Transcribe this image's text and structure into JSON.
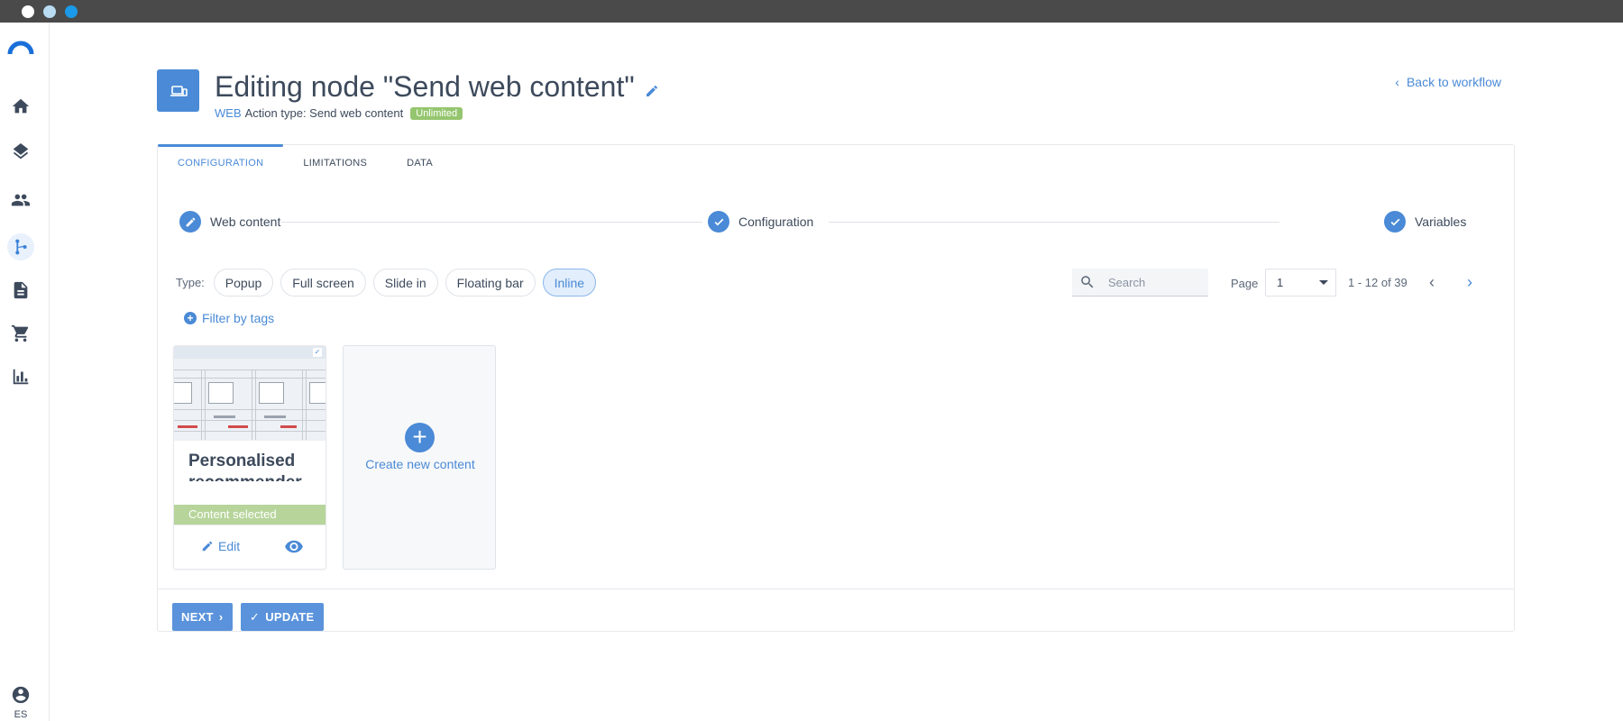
{
  "header": {
    "title": "Editing node \"Send web content\"",
    "channel": "WEB",
    "action_type": "Action type: Send web content",
    "badge": "Unlimited",
    "back_link": "Back to workflow"
  },
  "sidebar": {
    "items": [
      {
        "icon": "home-icon"
      },
      {
        "icon": "layers-icon"
      },
      {
        "icon": "people-icon"
      },
      {
        "icon": "workflow-icon",
        "active": true
      },
      {
        "icon": "document-icon"
      },
      {
        "icon": "cart-icon"
      },
      {
        "icon": "bar-chart-icon"
      }
    ],
    "user_label": "ES"
  },
  "tabs": [
    {
      "label": "CONFIGURATION",
      "active": true
    },
    {
      "label": "LIMITATIONS"
    },
    {
      "label": "DATA"
    }
  ],
  "stepper": {
    "steps": [
      {
        "label": "Web content",
        "icon": "pencil-icon"
      },
      {
        "label": "Configuration",
        "icon": "check-icon"
      },
      {
        "label": "Variables",
        "icon": "check-icon"
      }
    ]
  },
  "filters": {
    "type_label": "Type:",
    "types": [
      "Popup",
      "Full screen",
      "Slide in",
      "Floating bar",
      "Inline"
    ],
    "active_type": "Inline",
    "filter_by_tags": "Filter by tags"
  },
  "search": {
    "placeholder": "Search",
    "value": ""
  },
  "pagination": {
    "page_label": "Page",
    "page_value": "1",
    "range": "1 - 12 of 39"
  },
  "content_cards": [
    {
      "title": "Personalised recommender",
      "status": "Content selected",
      "edit_label": "Edit"
    }
  ],
  "create_card": {
    "label": "Create new content"
  },
  "footer": {
    "next_label": "NEXT",
    "update_label": "UPDATE"
  },
  "colors": {
    "accent": "#4a8ad6",
    "selected_green": "#b7d59b",
    "badge_green": "#95c66f"
  }
}
